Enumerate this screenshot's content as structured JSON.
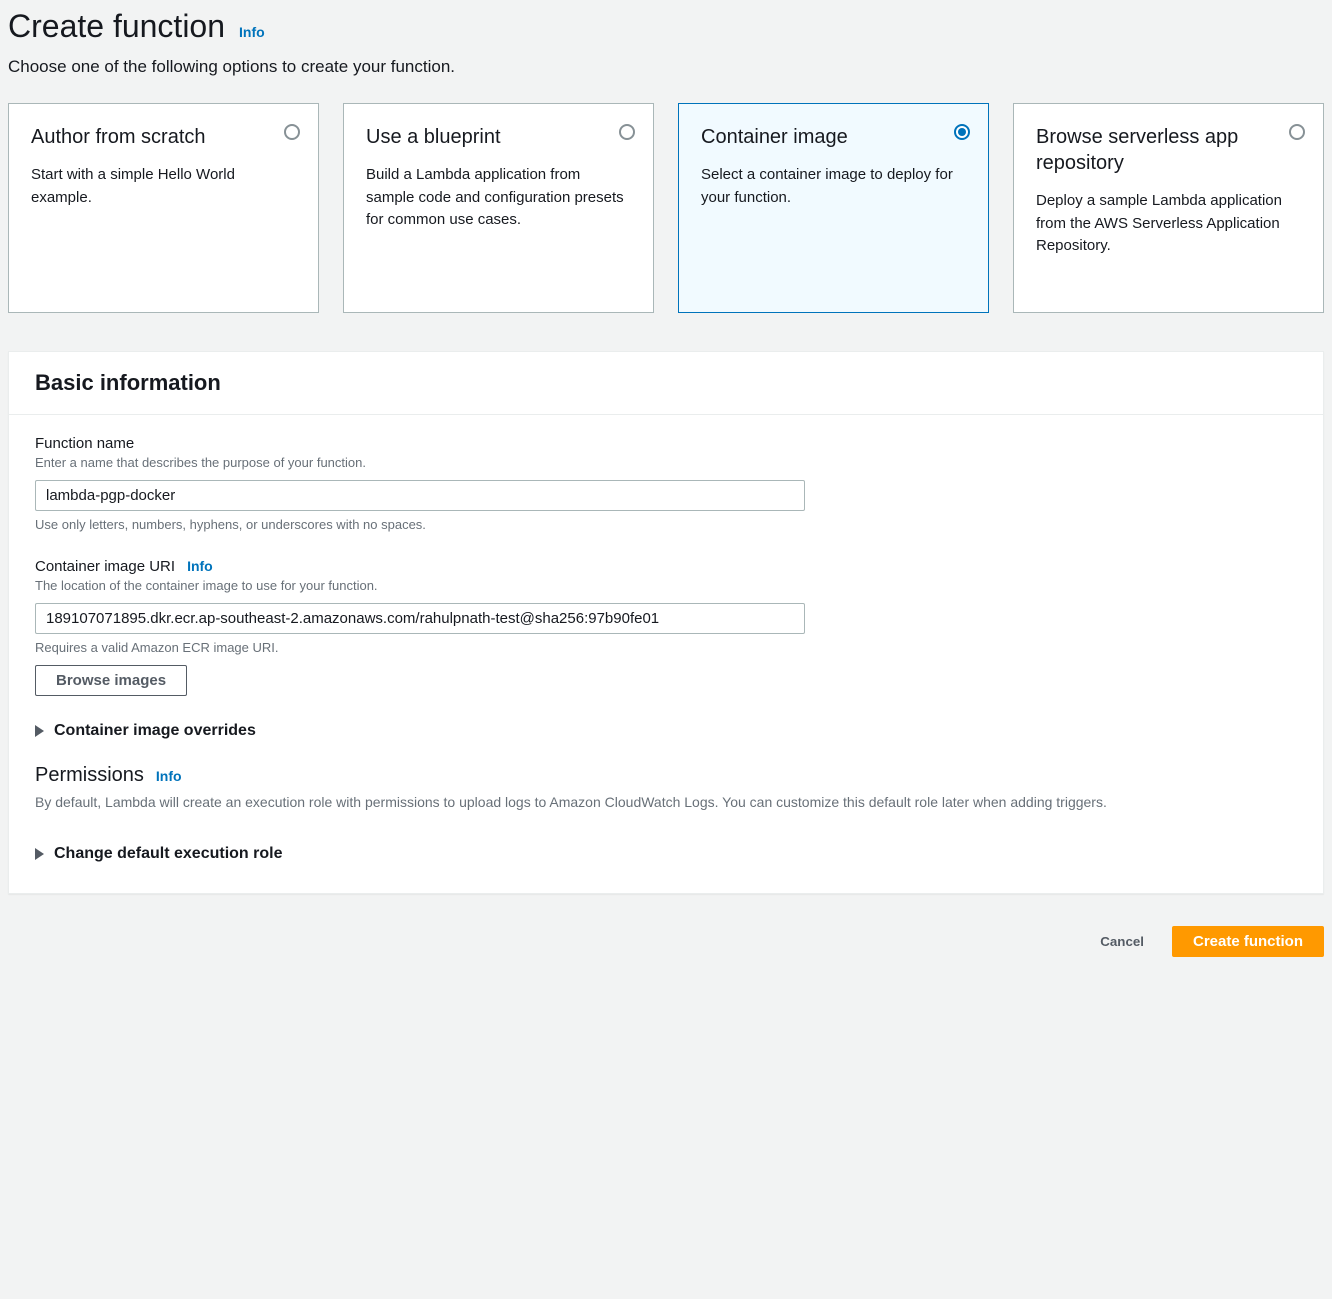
{
  "header": {
    "title": "Create function",
    "info": "Info",
    "subtitle": "Choose one of the following options to create your function."
  },
  "options": [
    {
      "title": "Author from scratch",
      "desc": "Start with a simple Hello World example.",
      "selected": false
    },
    {
      "title": "Use a blueprint",
      "desc": "Build a Lambda application from sample code and configuration presets for common use cases.",
      "selected": false
    },
    {
      "title": "Container image",
      "desc": "Select a container image to deploy for your function.",
      "selected": true
    },
    {
      "title": "Browse serverless app repository",
      "desc": "Deploy a sample Lambda application from the AWS Serverless Application Repository.",
      "selected": false
    }
  ],
  "basic": {
    "panel_title": "Basic information",
    "function_name": {
      "label": "Function name",
      "desc": "Enter a name that describes the purpose of your function.",
      "value": "lambda-pgp-docker",
      "hint": "Use only letters, numbers, hyphens, or underscores with no spaces."
    },
    "container_uri": {
      "label": "Container image URI",
      "info": "Info",
      "desc": "The location of the container image to use for your function.",
      "value": "189107071895.dkr.ecr.ap-southeast-2.amazonaws.com/rahulpnath-test@sha256:97b90fe01",
      "hint": "Requires a valid Amazon ECR image URI.",
      "browse_button": "Browse images"
    },
    "overrides_expander": "Container image overrides",
    "permissions": {
      "title": "Permissions",
      "info": "Info",
      "desc": "By default, Lambda will create an execution role with permissions to upload logs to Amazon CloudWatch Logs. You can customize this default role later when adding triggers.",
      "expander": "Change default execution role"
    }
  },
  "footer": {
    "cancel": "Cancel",
    "create": "Create function"
  }
}
